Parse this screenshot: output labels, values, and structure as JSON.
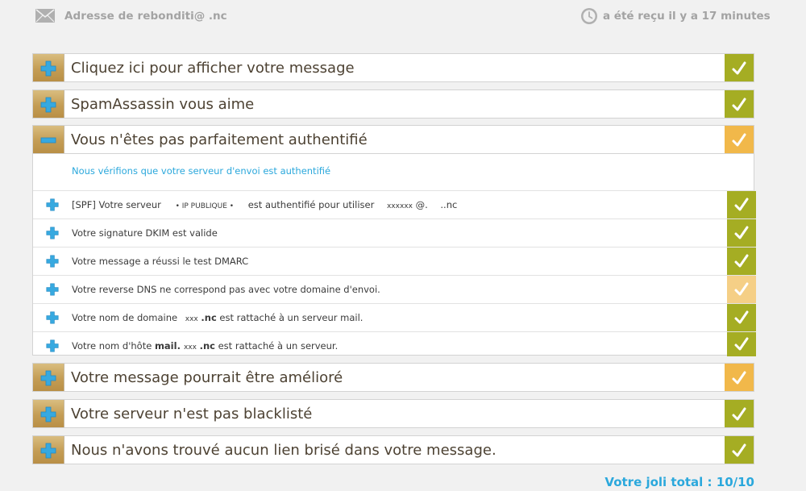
{
  "header": {
    "bounce_label": "Adresse de rebond :",
    "bounce_email": "            iti@       .nc",
    "received": "a été reçu il y a 17 minutes"
  },
  "rows": [
    {
      "label": "Cliquez ici pour afficher votre message",
      "state": "plus",
      "status": "green"
    },
    {
      "label": "SpamAssassin vous aime",
      "state": "plus",
      "status": "green"
    },
    {
      "label": "Vous n'êtes pas parfaitement authentifié",
      "state": "minus",
      "status": "orange"
    },
    {
      "label": "Votre message pourrait être amélioré",
      "state": "plus",
      "status": "orange"
    },
    {
      "label": "Votre serveur n'est pas blacklisté",
      "state": "plus",
      "status": "green"
    },
    {
      "label": "Nous n'avons trouvé aucun lien brisé dans votre message.",
      "state": "plus",
      "status": "green"
    }
  ],
  "panel": {
    "intro": "Nous vérifions que votre serveur d'envoi est authentifié",
    "items": [
      {
        "prefix": "[SPF] Votre serveur",
        "ip": "• IP PUBLIQUE •",
        "middle": "est authentifié pour utiliser",
        "user": "xxxxxx",
        "at": "@.",
        "domain": "..nc",
        "status": "green"
      },
      {
        "text": "Votre signature DKIM est valide",
        "status": "green"
      },
      {
        "text": "Votre message a réussi le test DMARC",
        "status": "green"
      },
      {
        "text": "Votre reverse DNS ne correspond pas avec votre domaine d'envoi.",
        "status": "pale"
      },
      {
        "prefix": "Votre nom de domaine",
        "mask": "xxx",
        "tld": ".nc",
        "suffix": "est rattaché à un serveur mail.",
        "status": "green"
      },
      {
        "prefix": "Votre nom d'hôte",
        "host": "mail.",
        "mask": "xxx",
        "tld": ".nc",
        "suffix": "est rattaché à un serveur.",
        "status": "green"
      }
    ]
  },
  "total": "Votre joli total : 10/10"
}
